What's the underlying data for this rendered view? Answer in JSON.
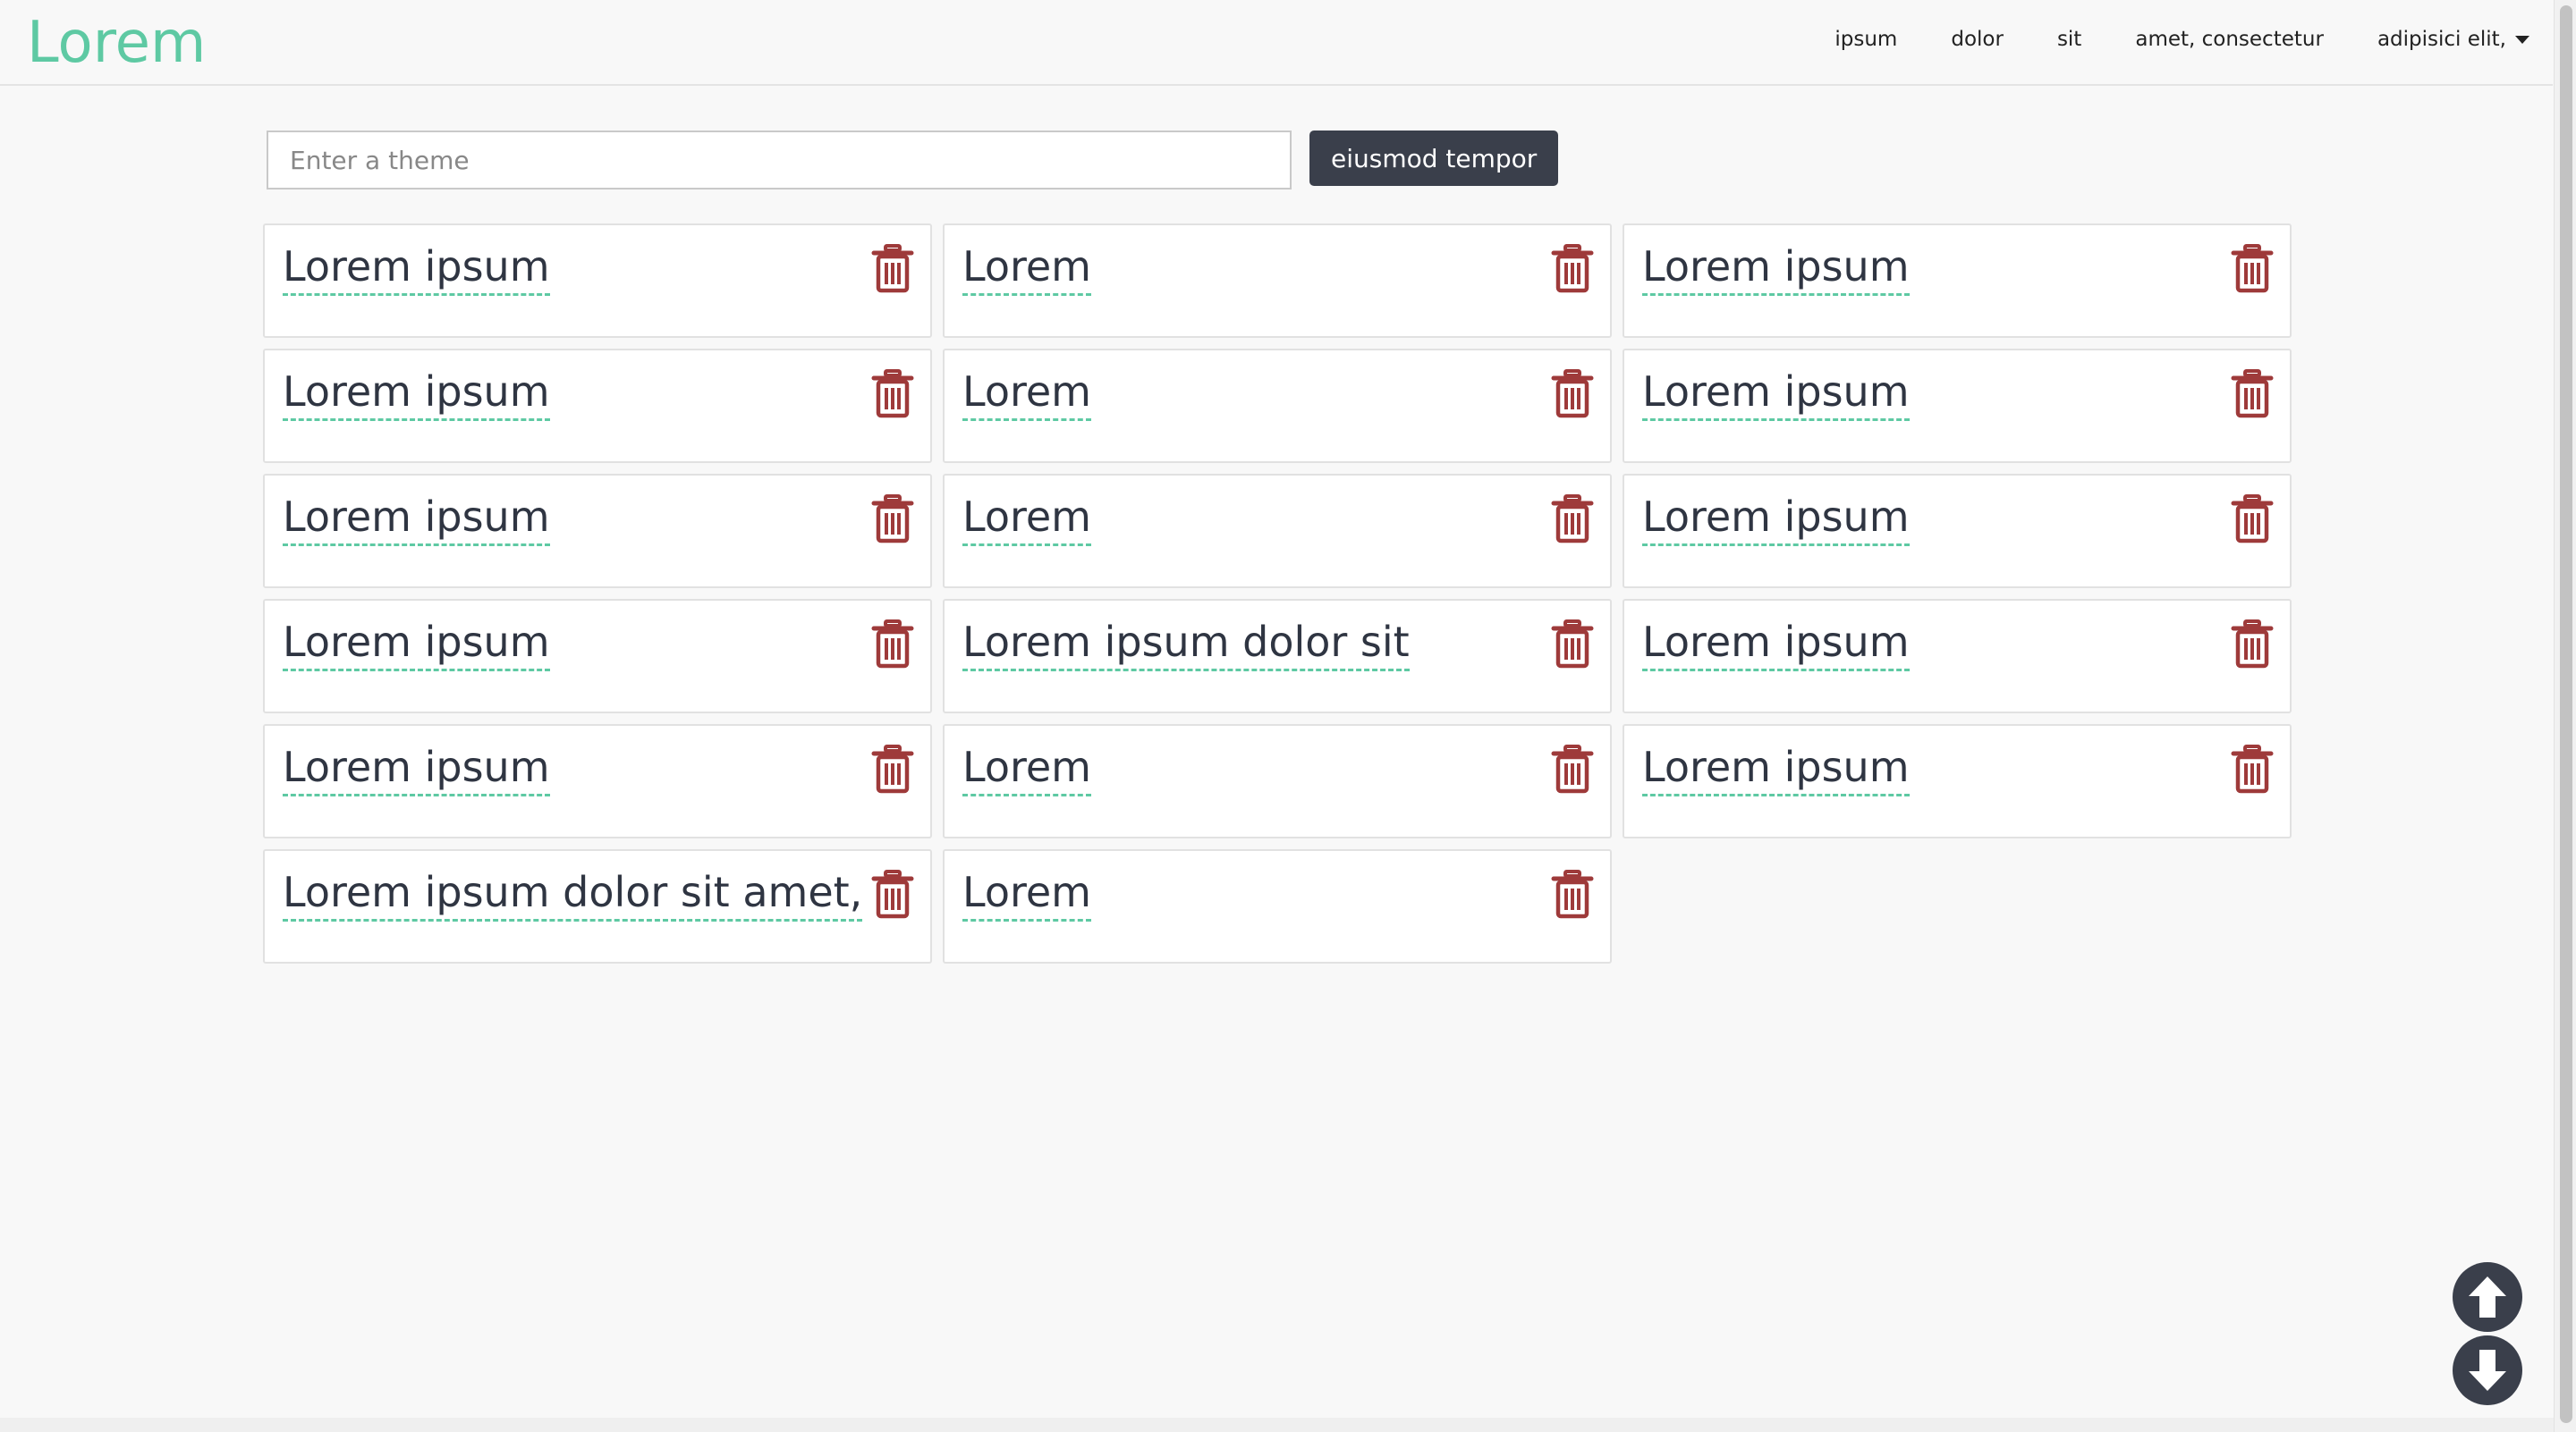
{
  "app": {
    "brand": "Lorem"
  },
  "nav": {
    "items": [
      "ipsum",
      "dolor",
      "sit",
      "amet, consectetur"
    ],
    "dropdown_label": "adipisici elit,"
  },
  "search": {
    "placeholder": "Enter a theme",
    "value": "",
    "button_label": "eiusmod tempor"
  },
  "themes": [
    "Lorem ipsum",
    "Lorem",
    "Lorem ipsum",
    "Lorem ipsum",
    "Lorem",
    "Lorem ipsum",
    "Lorem ipsum",
    "Lorem",
    "Lorem ipsum",
    "Lorem ipsum",
    "Lorem ipsum dolor sit",
    "Lorem ipsum",
    "Lorem ipsum",
    "Lorem",
    "Lorem ipsum",
    "Lorem ipsum dolor sit amet,",
    "Lorem"
  ],
  "icons": {
    "delete": "trash-icon",
    "scroll_up": "arrow-up-circle-icon",
    "scroll_down": "arrow-down-circle-icon"
  },
  "colors": {
    "brand": "#5ec9a3",
    "trash": "#9e3a3a",
    "dark": "#3a3f4b",
    "underline": "#5ec9a3"
  }
}
